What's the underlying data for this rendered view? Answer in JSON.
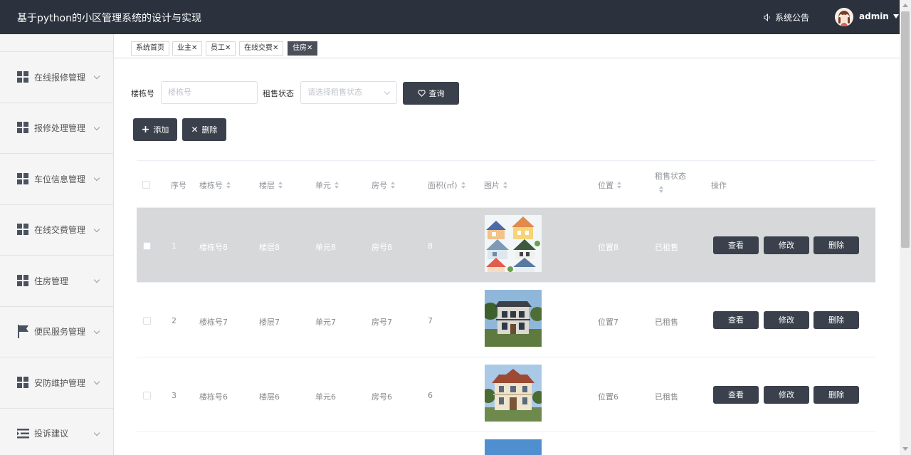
{
  "header": {
    "title": "基于python的小区管理系统的设计与实现",
    "notice_label": "系统公告",
    "username": "admin"
  },
  "sidebar": {
    "items": [
      {
        "label": "在线报修管理",
        "icon": "grid-icon"
      },
      {
        "label": "报修处理管理",
        "icon": "grid-icon"
      },
      {
        "label": "车位信息管理",
        "icon": "grid-icon"
      },
      {
        "label": "在线交费管理",
        "icon": "grid-icon"
      },
      {
        "label": "住房管理",
        "icon": "grid-icon"
      },
      {
        "label": "便民服务管理",
        "icon": "flag-icon"
      },
      {
        "label": "安防维护管理",
        "icon": "grid-icon"
      },
      {
        "label": "投诉建议",
        "icon": "list-icon"
      }
    ]
  },
  "tabs": [
    {
      "label": "系统首页",
      "closable": false
    },
    {
      "label": "业主",
      "closable": true
    },
    {
      "label": "员工",
      "closable": true
    },
    {
      "label": "在线交费",
      "closable": true
    },
    {
      "label": "住房",
      "closable": true,
      "active": true
    }
  ],
  "search": {
    "building_label": "楼栋号",
    "building_placeholder": "楼栋号",
    "status_label": "租售状态",
    "status_placeholder": "请选择租售状态",
    "query_button": "查询"
  },
  "actions": {
    "add": "添加",
    "delete": "删除"
  },
  "table": {
    "headers": [
      "序号",
      "楼栋号",
      "楼层",
      "单元",
      "房号",
      "面积(㎡)",
      "图片",
      "位置",
      "租售状态",
      "操作"
    ],
    "row_actions": {
      "view": "查看",
      "edit": "修改",
      "delete": "删除"
    },
    "rows": [
      {
        "index": "1",
        "building": "楼栋号8",
        "floor": "楼层8",
        "unit": "单元8",
        "room": "房号8",
        "area": "8",
        "location": "位置8",
        "status": "已租售",
        "image": "houses-cartoon"
      },
      {
        "index": "2",
        "building": "楼栋号7",
        "floor": "楼层7",
        "unit": "单元7",
        "room": "房号7",
        "area": "7",
        "location": "位置7",
        "status": "已租售",
        "image": "villa-modern"
      },
      {
        "index": "3",
        "building": "楼栋号6",
        "floor": "楼层6",
        "unit": "单元6",
        "room": "房号6",
        "area": "6",
        "location": "位置6",
        "status": "已租售",
        "image": "villa-classic"
      }
    ]
  },
  "colors": {
    "topbar": "#2b323e",
    "button": "#3a414c",
    "highlight_row": "#d7d8da"
  }
}
